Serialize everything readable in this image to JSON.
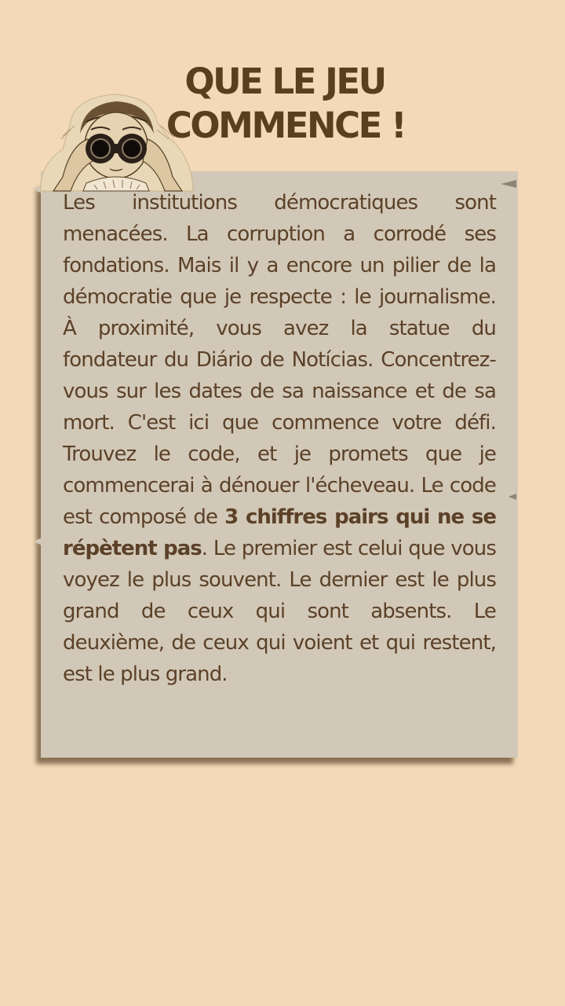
{
  "header": {
    "title_line1": "QUE LE JEU",
    "title_line2": "COMMENCE !"
  },
  "card": {
    "text_part1": "Les institutions démocratiques sont menacées. La corruption a corrodé ses fondations. Mais il y a encore un pilier de la démocratie que je respecte : le journalisme. À proximité, vous avez la statue du fondateur du Diário de Notícias. Concentrez-vous sur les dates de sa naissance et de sa mort. C'est ici que commence votre défi. Trouvez le code, et je promets que je commencerai à dénouer l'écheveau. Le code est composé de ",
    "text_bold": "3 chiffres pairs qui ne se répètent pas",
    "text_part2": ". Le premier est celui que vous voyez le plus souvent. Le dernier est le plus grand de ceux qui sont absents. Le deuxième, de ceux qui voient et qui restent, est le plus grand."
  },
  "colors": {
    "background": "#f3d9b7",
    "paper": "#d2c8b7",
    "text": "#5b4128",
    "title": "#5a3f1f"
  },
  "icons": {
    "figure": "woman-with-binoculars-illustration"
  }
}
